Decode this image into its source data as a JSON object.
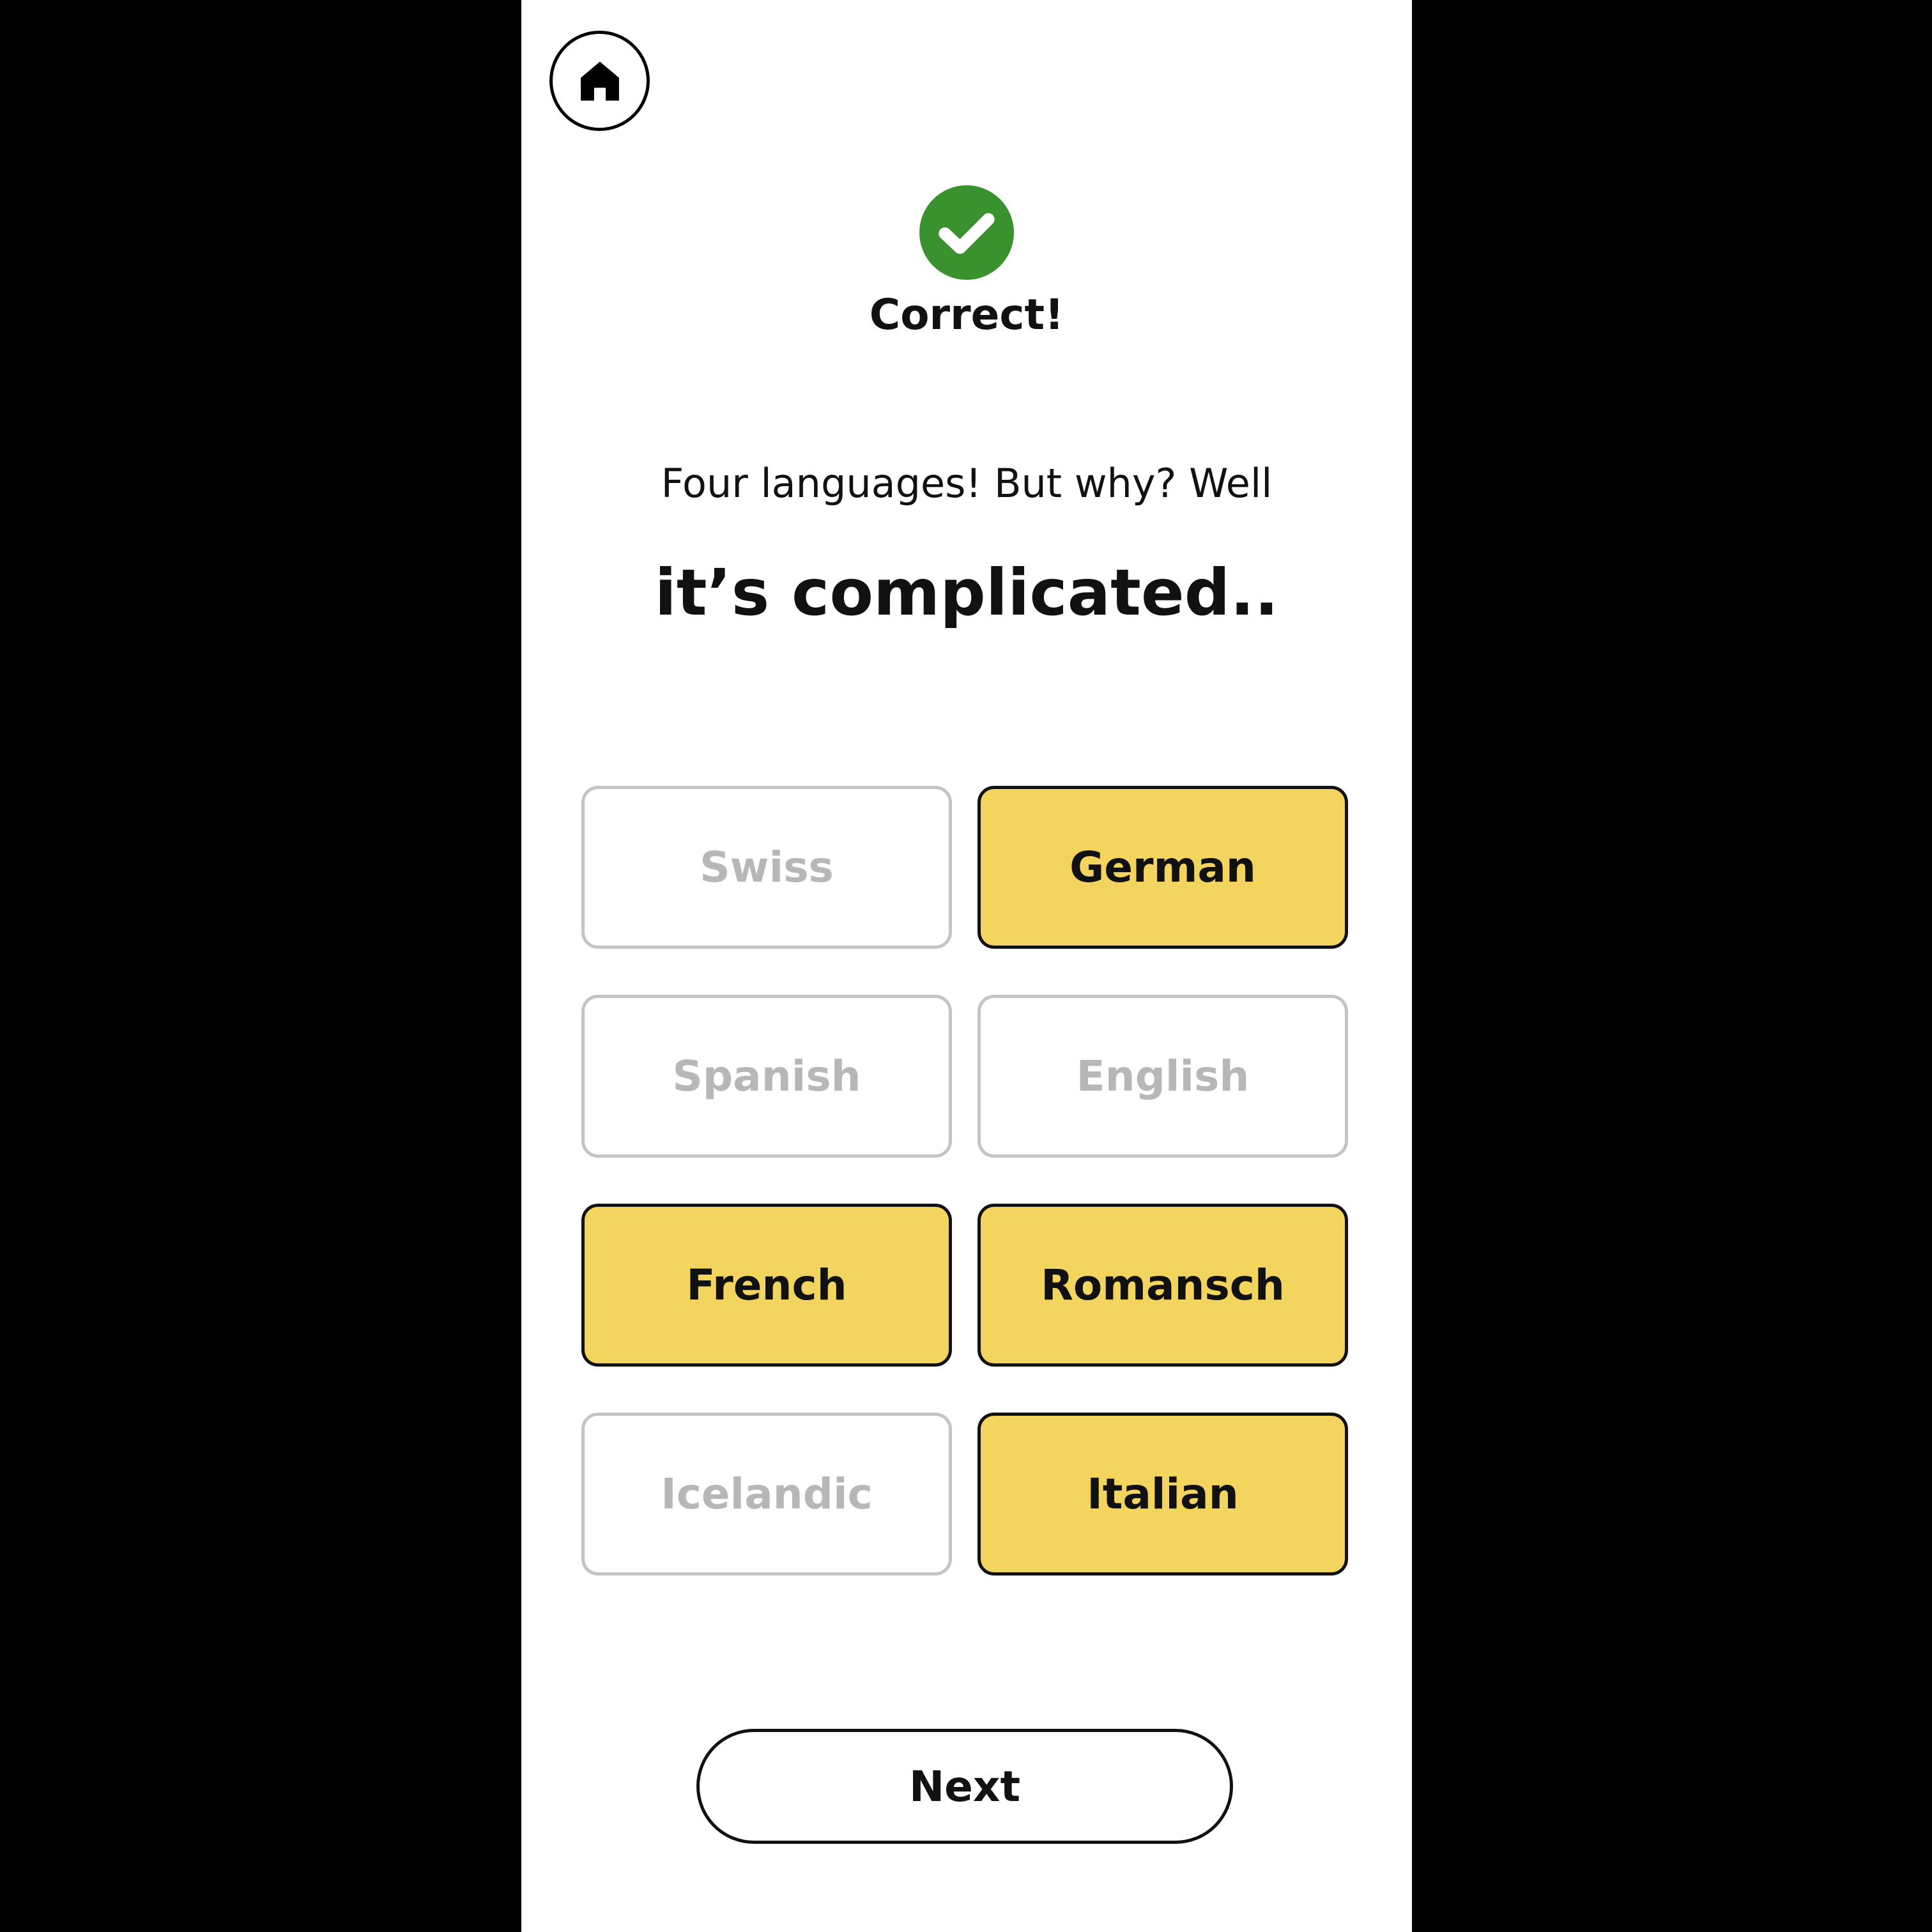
{
  "header": {
    "home_icon": "home-icon"
  },
  "feedback": {
    "icon": "check-circle-icon",
    "icon_color": "#3a922f",
    "text": "Correct!"
  },
  "content": {
    "subtitle": "Four languages! But why? Well",
    "headline": "it’s complicated.."
  },
  "options": [
    {
      "label": "Swiss",
      "selected": false
    },
    {
      "label": "German",
      "selected": true
    },
    {
      "label": "Spanish",
      "selected": false
    },
    {
      "label": "English",
      "selected": false
    },
    {
      "label": "French",
      "selected": true
    },
    {
      "label": "Romansch",
      "selected": true
    },
    {
      "label": "Icelandic",
      "selected": false
    },
    {
      "label": "Italian",
      "selected": true
    }
  ],
  "colors": {
    "selected_fill": "#f2d45f",
    "unselected_text": "#b7b7b7",
    "unselected_border": "#c4c4c4"
  },
  "footer": {
    "next_label": "Next"
  }
}
